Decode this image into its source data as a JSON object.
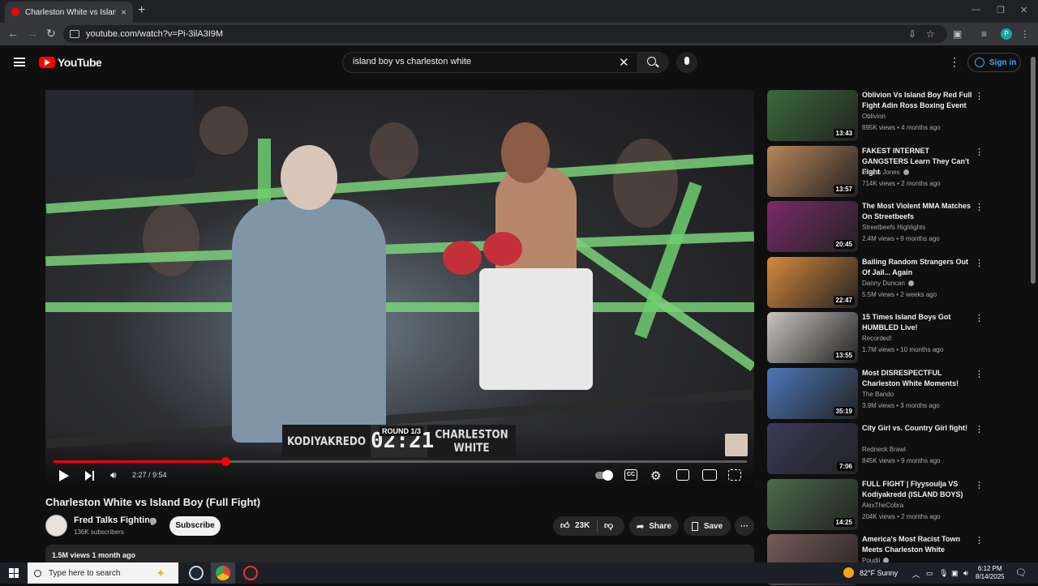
{
  "browser": {
    "tab_title": "Charleston White vs Island Boy",
    "tab_close": "×",
    "new_tab": "+",
    "url": "youtube.com/watch?v=Pi-3ilA3I9M",
    "profile_initial": "P"
  },
  "header": {
    "logo_text": "YouTube",
    "search_value": "island boy vs charleston white",
    "clear_glyph": "✕",
    "signin_label": "Sign in"
  },
  "player": {
    "round_label": "ROUND 1/3",
    "fighter_left": "KODIYAKREDO",
    "clock": "02:21",
    "fighter_right": "CHARLESTON WHITE",
    "time_display": "2:27 / 9:54",
    "progress_fraction": 0.248,
    "cc_label": "CC"
  },
  "video": {
    "title": "Charleston White vs Island Boy (Full Fight)",
    "channel": "Fred Talks Fighting",
    "subscribers": "136K subscribers",
    "subscribe_label": "Subscribe",
    "likes": "23K",
    "share_label": "Share",
    "save_label": "Save",
    "views_and_date": "1.5M views  1 month ago"
  },
  "recommendations": [
    {
      "title": "Oblivion Vs Island Boy Red Full Fight Adin Ross Boxing Event",
      "channel": "Oblivion",
      "verified": false,
      "meta": "895K views • 4 months ago",
      "duration": "13:43",
      "color": "#3a6b3a"
    },
    {
      "title": "FAKEST INTERNET GANGSTERS Learn They Can't Fight",
      "channel": "Shaun Jones",
      "verified": true,
      "meta": "714K views • 2 months ago",
      "duration": "13:57",
      "color": "#b8865b"
    },
    {
      "title": "The Most Violent MMA Matches On Streetbeefs",
      "channel": "Streetbeefs Highlights",
      "verified": false,
      "meta": "2.4M views • 9 months ago",
      "duration": "20:45",
      "color": "#7a2a6a"
    },
    {
      "title": "Bailing Random Strangers Out Of Jail... Again",
      "channel": "Danny Duncan",
      "verified": true,
      "meta": "5.5M views • 2 weeks ago",
      "duration": "22:47",
      "color": "#d88a3c"
    },
    {
      "title": "15 Times Island Boys Got HUMBLED Live!",
      "channel": "Recorded!",
      "verified": false,
      "meta": "1.7M views • 10 months ago",
      "duration": "13:55",
      "color": "#c9c4c0"
    },
    {
      "title": "Most DISRESPECTFUL Charleston White Moments!",
      "channel": "The Bando",
      "verified": false,
      "meta": "3.9M views • 3 months ago",
      "duration": "35:19",
      "color": "#4b78b8"
    },
    {
      "title": "City Girl vs. Country Girl fight!",
      "channel": "Redneck Brawl",
      "verified": false,
      "meta": "845K views • 9 months ago",
      "duration": "7:06",
      "color": "#3a3a5a"
    },
    {
      "title": "FULL FIGHT | Flyysoulja VS Kodiyakredd (ISLAND BOYS)",
      "channel": "AlexTheCobra",
      "verified": false,
      "meta": "204K views • 2 months ago",
      "duration": "14:25",
      "color": "#4a6a4a"
    },
    {
      "title": "America's Most Racist Town Meets Charleston White",
      "channel": "Poudii",
      "verified": true,
      "meta": "",
      "duration": "",
      "color": "#7a5a5a"
    }
  ],
  "taskbar": {
    "search_placeholder": "Type here to search",
    "weather": "82°F  Sunny",
    "time": "6:12 PM",
    "date": "8/14/2025"
  },
  "icons": {
    "menu": "hamburger-icon",
    "search": "search-icon",
    "mic": "mic-icon",
    "like": "thumbs-up-icon",
    "dislike": "thumbs-down-icon",
    "share": "share-icon",
    "save": "bookmark-icon",
    "more": "more-horiz-icon"
  }
}
